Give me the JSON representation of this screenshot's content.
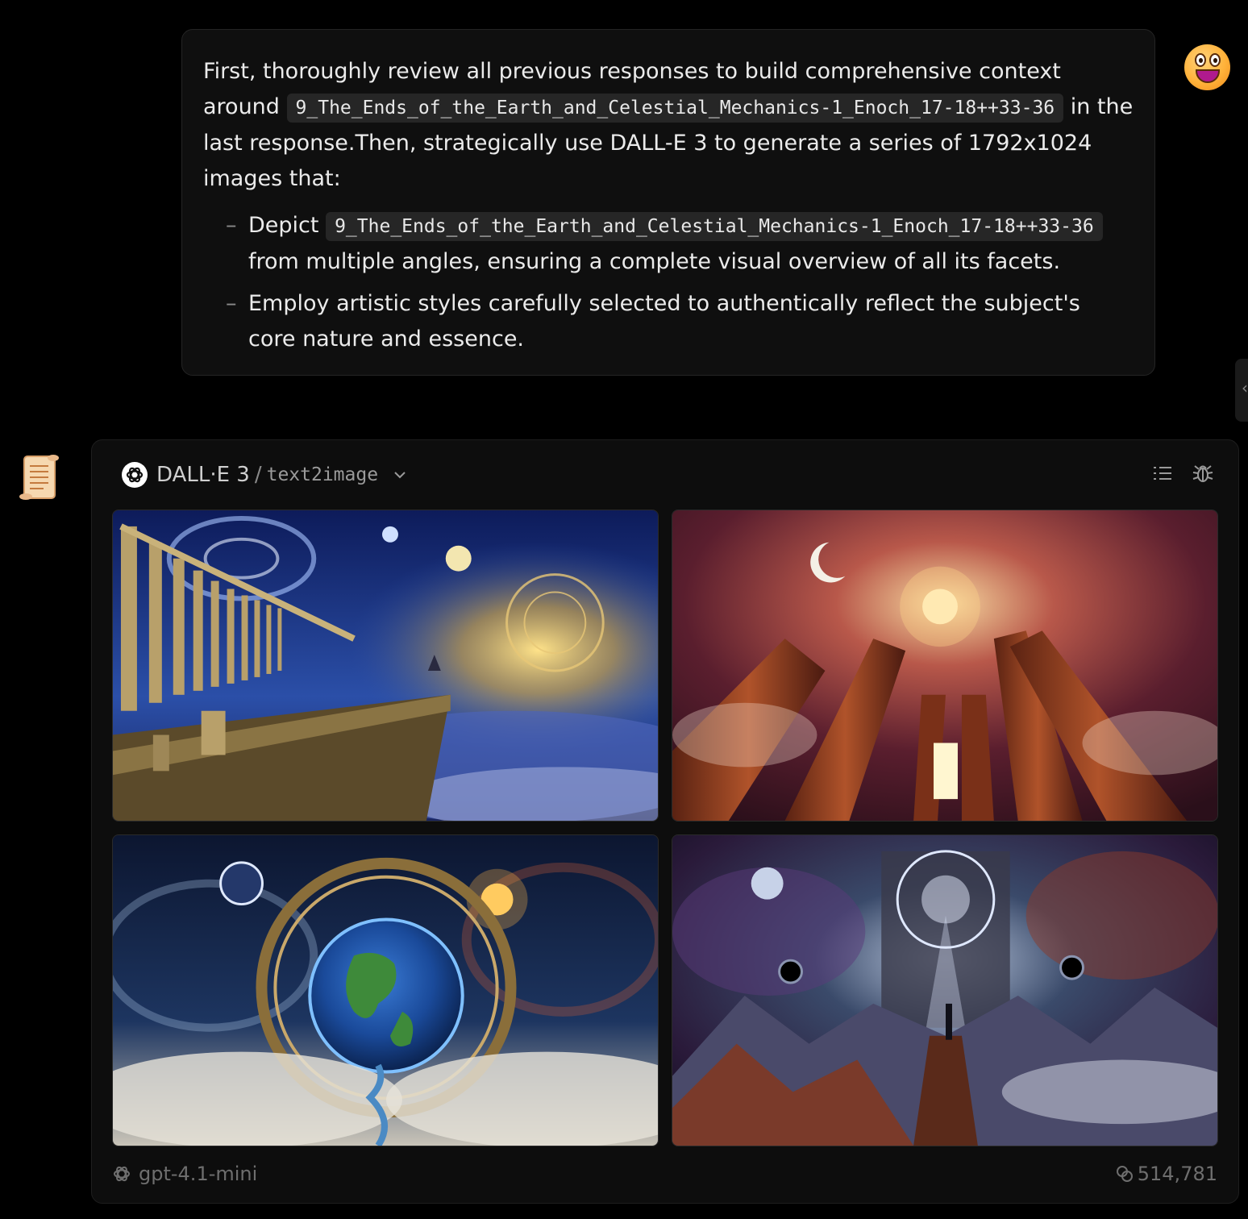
{
  "user_message": {
    "line1": "First, thoroughly review all previous responses to build comprehensive context around",
    "code1": "9_The_Ends_of_the_Earth_and_Celestial_Mechanics-1_Enoch_17-18++33-36",
    "after_code1": "in the last response.Then, strategically use DALL-E 3 to generate a series of 1792x1024 images that:",
    "bullets": [
      {
        "prefix": "Depict",
        "code": "9_The_Ends_of_the_Earth_and_Celestial_Mechanics-1_Enoch_17-18++33-36",
        "suffix": "from multiple angles, ensuring a complete visual overview of all its facets."
      },
      {
        "text": "Employ artistic styles carefully selected to authentically reflect the subject's core nature and essence."
      }
    ],
    "bullet_marker": "–"
  },
  "tool_card": {
    "model": "DALL·E 3",
    "separator": "/",
    "mode": "text2image",
    "images": [
      {
        "icon": "generated-image-pillars-cliff"
      },
      {
        "icon": "generated-image-cosmic-columns"
      },
      {
        "icon": "generated-image-earth-portal"
      },
      {
        "icon": "generated-image-celestial-gate"
      }
    ],
    "footer_model": "gpt-4.1-mini",
    "token_count": "514,781"
  },
  "colors": {
    "background": "#000000",
    "bubble": "#0f0f0f",
    "card": "#0d0d0d",
    "code_bg": "#262626",
    "muted_text": "#6e6e6e"
  }
}
